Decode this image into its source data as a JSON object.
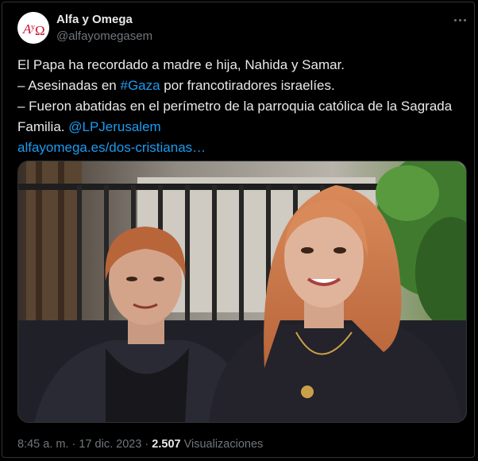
{
  "tweet": {
    "author": {
      "display_name": "Alfa y Omega",
      "handle": "@alfayomegasem",
      "avatar_logo_text": "AyO"
    },
    "more_icon": "more-horizontal-icon",
    "text": {
      "line1": "El Papa ha recordado a madre e hija, Nahida y Samar.",
      "line2_prefix": "– Asesinadas en ",
      "hashtag": "#Gaza",
      "line2_suffix": " por francotiradores israelíes.",
      "line3": "– Fueron abatidas en el perímetro de la parroquia católica de la Sagrada",
      "line4_prefix": "Familia. ",
      "mention": "@LPJerusalem",
      "url": "alfayomega.es/dos-cristianas…"
    },
    "meta": {
      "time": "8:45 a. m.",
      "separator": " · ",
      "date": "17 dic. 2023",
      "views_count": "2.507",
      "views_label": "Visualizaciones"
    }
  },
  "colors": {
    "background": "#000000",
    "text_primary": "#e7e9ea",
    "text_secondary": "#71767b",
    "link": "#1d9bf0",
    "border": "#2f3336",
    "logo_red": "#c8102e"
  }
}
